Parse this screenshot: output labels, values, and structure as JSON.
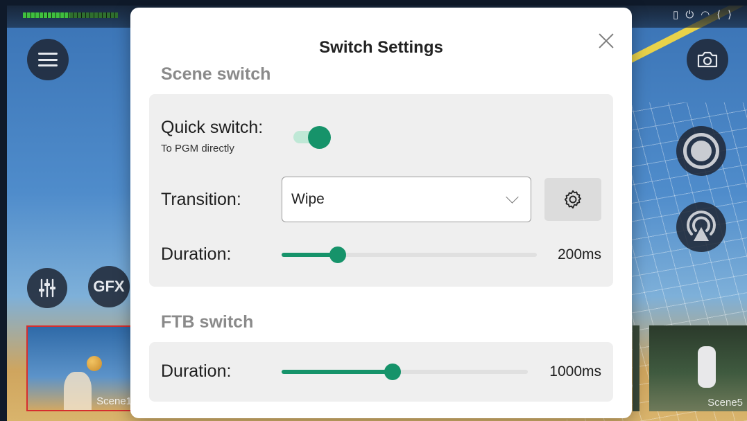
{
  "background": {
    "thumbnails": [
      {
        "label": "Scene1",
        "selected": true
      },
      {
        "label": "Scene5",
        "selected": false
      }
    ],
    "buttons": {
      "gfx_label": "GFX"
    }
  },
  "dialog": {
    "title": "Switch Settings",
    "scene_switch": {
      "section_title": "Scene switch",
      "quick_switch": {
        "label": "Quick switch:",
        "sublabel": "To PGM directly",
        "enabled": true
      },
      "transition": {
        "label": "Transition:",
        "value": "Wipe"
      },
      "duration": {
        "label": "Duration:",
        "value_text": "200ms",
        "fraction": 0.22
      }
    },
    "ftb_switch": {
      "section_title": "FTB switch",
      "duration": {
        "label": "Duration:",
        "value_text": "1000ms",
        "fraction": 0.45
      }
    }
  },
  "colors": {
    "accent": "#16936a",
    "toggle_track": "#bfe8d6",
    "card_bg": "#efefef",
    "record_indicator": "#d62e2e"
  }
}
